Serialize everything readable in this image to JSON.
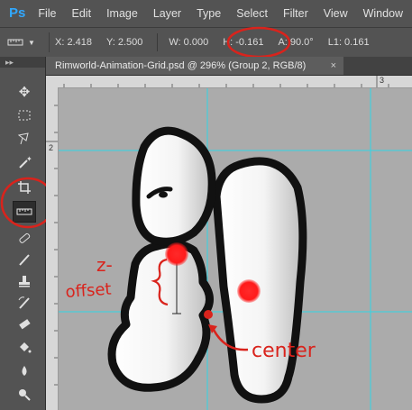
{
  "app": {
    "logo": "Ps",
    "menu": [
      "File",
      "Edit",
      "Image",
      "Layer",
      "Type",
      "Select",
      "Filter",
      "View",
      "Window"
    ]
  },
  "options_bar": {
    "tool_icon": "ruler-icon",
    "x": "X:  2.418",
    "y": "Y:  2.500",
    "w": "W:  0.000",
    "h": "H:  -0.161",
    "angle": "A:  90.0°",
    "l1": "L1:  0.161"
  },
  "document": {
    "tab_title": "Rimworld-Animation-Grid.psd @ 296% (Group 2, RGB/8)",
    "close_glyph": "×"
  },
  "rulers": {
    "top_label": "3",
    "left_label": "2"
  },
  "annotations": {
    "left_label_line1": "z-",
    "left_label_line2": "offset",
    "right_label": "center"
  },
  "colors": {
    "annotation_red": "#d9231c",
    "guide_cyan": "#32d6e6",
    "point_red": "#ff1a1a"
  },
  "tools": [
    {
      "name": "move-tool",
      "icon": "move-icon"
    },
    {
      "name": "marquee-tool",
      "icon": "marquee-icon"
    },
    {
      "name": "lasso-tool",
      "icon": "lasso-icon"
    },
    {
      "name": "magic-wand-tool",
      "icon": "magic-wand-icon"
    },
    {
      "name": "crop-tool",
      "icon": "crop-icon"
    },
    {
      "name": "ruler-tool",
      "icon": "ruler-icon",
      "active": true
    },
    {
      "name": "healing-tool",
      "icon": "bandage-icon"
    },
    {
      "name": "brush-tool",
      "icon": "brush-icon"
    },
    {
      "name": "stamp-tool",
      "icon": "stamp-icon"
    },
    {
      "name": "history-brush-tool",
      "icon": "history-brush-icon"
    },
    {
      "name": "eraser-tool",
      "icon": "eraser-icon"
    },
    {
      "name": "paint-bucket-tool",
      "icon": "bucket-icon"
    },
    {
      "name": "blur-tool",
      "icon": "blur-icon"
    },
    {
      "name": "dodge-tool",
      "icon": "dodge-icon"
    }
  ]
}
